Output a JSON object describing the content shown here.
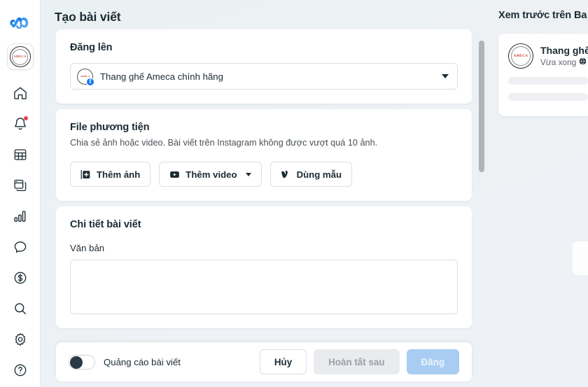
{
  "sidebar": {
    "logo_icon": "meta-logo-icon",
    "account": {
      "name": "AMECA",
      "avatar_icon": "business-avatar-icon"
    },
    "items": [
      {
        "icon": "home-icon",
        "label": "Trang chủ",
        "badge": ""
      },
      {
        "icon": "bell-icon",
        "label": "Thông báo",
        "badge": "dot"
      },
      {
        "icon": "grid-icon",
        "label": "Bảng tin",
        "badge": ""
      },
      {
        "icon": "content-icon",
        "label": "Nội dung",
        "badge": ""
      },
      {
        "icon": "bar-chart-icon",
        "label": "Thông tin chi tiết",
        "badge": ""
      },
      {
        "icon": "chat-bubble-icon",
        "label": "Hộp thư",
        "badge": ""
      },
      {
        "icon": "dollar-circle-icon",
        "label": "Kiếm tiền",
        "badge": ""
      },
      {
        "icon": "search-icon",
        "label": "Tìm kiếm",
        "badge": ""
      },
      {
        "icon": "gear-icon",
        "label": "Cài đặt",
        "badge": ""
      },
      {
        "icon": "help-circle-icon",
        "label": "Trợ giúp",
        "badge": ""
      }
    ]
  },
  "header": {
    "title": "Tạo bài viết"
  },
  "publish_to": {
    "title": "Đăng lên",
    "selected_page": "Thang ghế Ameca chính hãng",
    "platform_badge": "facebook-icon",
    "caret_icon": "chevron-down-icon"
  },
  "media": {
    "title": "File phương tiện",
    "subtitle": "Chia sẻ ảnh hoặc video. Bài viết trên Instagram không được vượt quá 10 ảnh.",
    "buttons": [
      {
        "label": "Thêm ảnh",
        "icon": "add-photo-icon",
        "has_caret": false
      },
      {
        "label": "Thêm video",
        "icon": "video-icon",
        "has_caret": true
      },
      {
        "label": "Dùng mẫu",
        "icon": "template-v-icon",
        "has_caret": false
      }
    ]
  },
  "details": {
    "title": "Chi tiết bài viết",
    "text_label": "Văn bản",
    "text_value": "",
    "text_placeholder": ""
  },
  "footer": {
    "boost_toggle_label": "Quảng cáo bài viết",
    "boost_toggle_on": false,
    "cancel_label": "Hủy",
    "finish_later_label": "Hoàn tất sau",
    "publish_label": "Đăng"
  },
  "preview": {
    "title": "Xem trước trên Ba",
    "post": {
      "page_name": "Thang ghế",
      "timestamp": "Vừa xong",
      "audience_icon": "globe-icon",
      "avatar_text": "AMECA"
    }
  },
  "colors": {
    "meta_blue": "#1877f2",
    "accent_primary": "#a9cdf2",
    "notification_red": "#e8405a",
    "text_primary": "#1c2b33",
    "text_secondary": "#606770",
    "page_bg": "#eef1f4",
    "card_bg": "#ffffff",
    "brand_red": "#c0392b"
  }
}
